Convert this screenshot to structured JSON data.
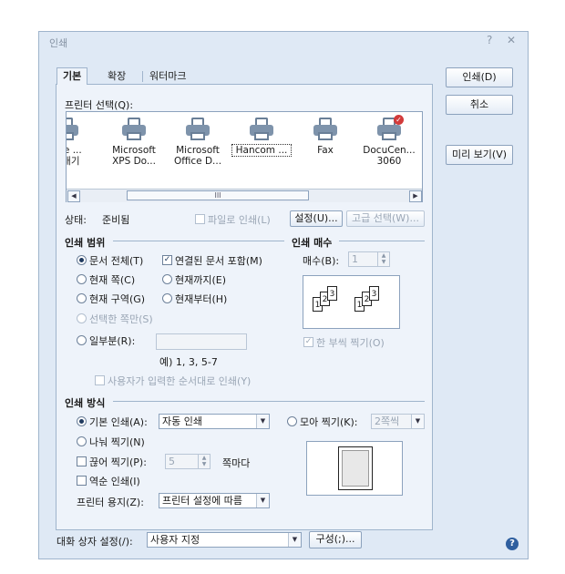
{
  "window": {
    "title": "인쇄",
    "help_glyph": "?",
    "close_glyph": "✕"
  },
  "tabs": [
    {
      "label": "기본",
      "active": true
    },
    {
      "label": "확장",
      "active": false
    },
    {
      "label": "워터마크",
      "active": false
    }
  ],
  "right_buttons": {
    "print": "인쇄(D)",
    "cancel": "취소",
    "preview": "미리 보기(V)"
  },
  "printer_select": {
    "label": "프린터 선택(Q):",
    "printers": [
      {
        "name1": "Jote ...",
        "name2": "보내기",
        "badge": false
      },
      {
        "name1": "Microsoft",
        "name2": "XPS Do...",
        "badge": false
      },
      {
        "name1": "Microsoft",
        "name2": "Office D...",
        "badge": false
      },
      {
        "name1": "Hancom ...",
        "name2": "",
        "badge": true,
        "selected": true
      },
      {
        "name1": "Fax",
        "name2": "",
        "badge": false
      },
      {
        "name1": "DocuCen...",
        "name2": "3060",
        "badge": true
      }
    ],
    "scroll_thumb": "III"
  },
  "status": {
    "label": "상태:",
    "value": "준비됨",
    "print_to_file": "파일로 인쇄(L)",
    "settings_button": "설정(U)...",
    "advanced_button": "고급 선택(W)..."
  },
  "print_range": {
    "title": "인쇄 범위",
    "all_pages": "문서 전체(T)",
    "linked_docs": "연결된 문서 포함(M)",
    "current_page": "현재 쪽(C)",
    "until_current": "현재까지(E)",
    "current_section": "현재 구역(G)",
    "from_current": "현재부터(H)",
    "selected_pages": "선택한 쪽만(S)",
    "partial": "일부분(R):",
    "example": "예) 1, 3, 5-7",
    "user_order": "사용자가 입력한 순서대로 인쇄(Y)"
  },
  "copies": {
    "title": "인쇄 매수",
    "count_label": "매수(B):",
    "count_value": "1",
    "collate": "한 부씩 찍기(O)",
    "page_numbers": [
      "1",
      "2",
      "3"
    ]
  },
  "print_method": {
    "title": "인쇄 방식",
    "basic_print": "기본 인쇄(A):",
    "basic_value": "자동 인쇄",
    "split_print": "나눠 찍기(N)",
    "cut_print": "끊어 찍기(P):",
    "cut_value": "5",
    "per_page": "쪽마다",
    "reverse": "역순 인쇄(I)",
    "gather_print": "모아 찍기(K):",
    "gather_value": "2쪽씩",
    "paper_label": "프린터 용지(Z):",
    "paper_value": "프린터 설정에 따름"
  },
  "bottom": {
    "dialog_setting_label": "대화 상자 설정(/):",
    "dialog_setting_value": "사용자 지정",
    "configure_button": "구성(;)...",
    "help_icon_glyph": "?"
  },
  "colors": {
    "dialog_bg": "#dfe9f5",
    "panel_bg": "#eef3fa",
    "border": "#9fb4cc",
    "badge_red": "#d23b3b"
  }
}
